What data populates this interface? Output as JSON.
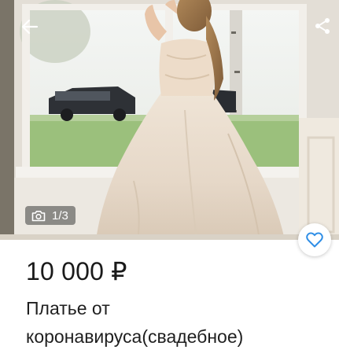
{
  "listing": {
    "price": "10 000 ₽",
    "title": "Платье от коронавируса(свадебное)",
    "photo_counter": "1/3",
    "photo_alt": "Wedding dress photo"
  },
  "icons": {
    "back": "arrow-left-icon",
    "share": "share-icon",
    "camera": "camera-icon",
    "favorite": "heart-outline-icon"
  },
  "colors": {
    "accent": "#2f8ee6",
    "text": "#1a1a1a",
    "overlay": "#3c3c3c"
  }
}
